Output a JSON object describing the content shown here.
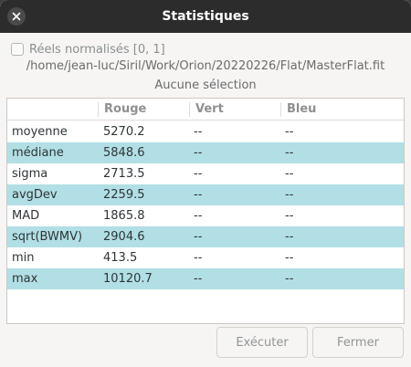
{
  "window": {
    "title": "Statistiques"
  },
  "options": {
    "normalize_label": "Réels normalisés [0, 1]",
    "normalize_checked": false
  },
  "file_path": "/home/jean-luc/Siril/Work/Orion/20220226/Flat/MasterFlat.fit",
  "selection_status": "Aucune sélection",
  "table": {
    "columns": [
      "",
      "Rouge",
      "Vert",
      "Bleu"
    ],
    "rows": [
      [
        "moyenne",
        "5270.2",
        "--",
        "--"
      ],
      [
        "médiane",
        "5848.6",
        "--",
        "--"
      ],
      [
        "sigma",
        "2713.5",
        "--",
        "--"
      ],
      [
        "avgDev",
        "2259.5",
        "--",
        "--"
      ],
      [
        "MAD",
        "1865.8",
        "--",
        "--"
      ],
      [
        "sqrt(BWMV)",
        "2904.6",
        "--",
        "--"
      ],
      [
        "min",
        "413.5",
        "--",
        "--"
      ],
      [
        "max",
        "10120.7",
        "--",
        "--"
      ]
    ]
  },
  "buttons": {
    "execute": "Exécuter",
    "close": "Fermer"
  },
  "colors": {
    "row_alt": "#b1dfe5",
    "titlebar": "#2c2c2c"
  }
}
